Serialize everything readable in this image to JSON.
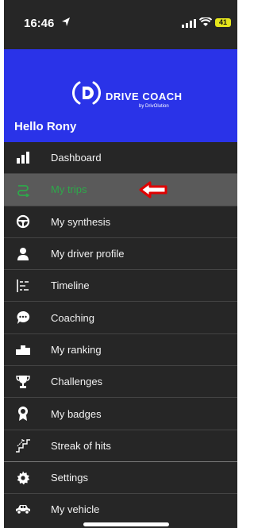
{
  "status_bar": {
    "time": "16:46",
    "battery": "41"
  },
  "header": {
    "logo_title": "DRIVE COACH",
    "logo_subtitle": "by DrivOlution",
    "greeting": "Hello Rony"
  },
  "menu": {
    "items": [
      {
        "label": "Dashboard",
        "icon": "bar-chart-icon"
      },
      {
        "label": "My trips",
        "icon": "route-icon",
        "active": true
      },
      {
        "label": "My synthesis",
        "icon": "steering-wheel-icon"
      },
      {
        "label": "My driver profile",
        "icon": "person-icon"
      },
      {
        "label": "Timeline",
        "icon": "timeline-icon"
      },
      {
        "label": "Coaching",
        "icon": "chat-bubble-icon"
      },
      {
        "label": "My ranking",
        "icon": "podium-icon"
      },
      {
        "label": "Challenges",
        "icon": "trophy-icon"
      },
      {
        "label": "My badges",
        "icon": "badge-icon"
      },
      {
        "label": "Streak of hits",
        "icon": "stairs-icon"
      },
      {
        "label": "Settings",
        "icon": "gear-icon"
      },
      {
        "label": "My vehicle",
        "icon": "car-icon"
      }
    ]
  },
  "colors": {
    "header_bg": "#2a33e8",
    "menu_bg": "#262626",
    "active_bg": "#5a5a5a",
    "active_text": "#2ea84a",
    "arrow": "#e00000"
  }
}
